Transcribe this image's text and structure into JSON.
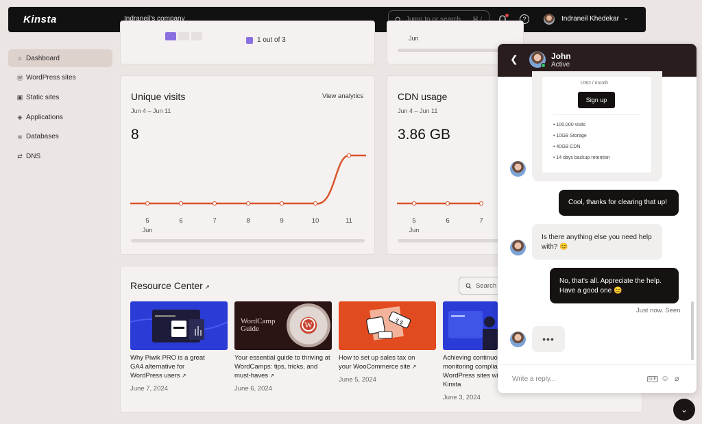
{
  "topbar": {
    "logo": "Kinsta",
    "company": "Indraneil's company",
    "search_placeholder": "Jump to or search...",
    "search_shortcut": "⌘ /",
    "user_name": "Indraneil Khedekar"
  },
  "sidebar": {
    "items": [
      {
        "label": "Dashboard",
        "icon": "home-icon"
      },
      {
        "label": "WordPress sites",
        "icon": "wordpress-icon"
      },
      {
        "label": "Static sites",
        "icon": "static-icon"
      },
      {
        "label": "Applications",
        "icon": "layers-icon"
      },
      {
        "label": "Databases",
        "icon": "database-icon"
      },
      {
        "label": "DNS",
        "icon": "dns-icon"
      }
    ]
  },
  "top_cards": {
    "legend_text": "1 out of 3",
    "jun_label": "Jun"
  },
  "unique_visits": {
    "title": "Unique visits",
    "date_range": "Jun 4 – Jun 11",
    "total": "8",
    "view_link": "View analytics",
    "month": "Jun"
  },
  "cdn_usage": {
    "title": "CDN usage",
    "date_range": "Jun 4 – Jun 11",
    "total": "3.86 GB",
    "month": "Jun"
  },
  "chart_data": [
    {
      "type": "area",
      "title": "Unique visits",
      "x": [
        5,
        6,
        7,
        8,
        9,
        10,
        11
      ],
      "x_month": "Jun",
      "values": [
        0,
        0,
        0,
        0,
        0,
        0,
        8
      ],
      "color": "#d9542b"
    },
    {
      "type": "line",
      "title": "CDN usage",
      "x": [
        5,
        6,
        7
      ],
      "x_month": "Jun",
      "values": [
        0,
        0,
        0
      ],
      "color": "#d9542b"
    }
  ],
  "resource_center": {
    "title": "Resource Center",
    "search_placeholder": "Search",
    "articles": [
      {
        "title": "Why Piwik PRO is a great GA4 alternative for WordPress users",
        "date": "June 7, 2024"
      },
      {
        "title": "Your essential guide to thriving at WordCamps: tips, tricks, and must-haves",
        "date": "June 6, 2024"
      },
      {
        "title": "How to set up sales tax on your WooCommerce site",
        "date": "June 5, 2024"
      },
      {
        "title": "Achieving continuous security monitoring compliance for WordPress sites with the Kinsta",
        "date": "June 3, 2024"
      }
    ],
    "wordcamp_thumb_text": "WordCamp Guide"
  },
  "chat": {
    "agent_name": "John",
    "agent_status": "Active",
    "plan_price_suffix": "USD / month",
    "plan_cta": "Sign up",
    "plan_features": [
      "100,000 visits",
      "10GB Storage",
      "40GB CDN",
      "14 days backup retention"
    ],
    "messages": [
      {
        "from": "user",
        "text": "Cool, thanks for clearing that up!"
      },
      {
        "from": "agent",
        "text": "Is there anything else you need help with? 😊"
      },
      {
        "from": "user",
        "text": "No, that's all. Appreciate the help. Have a good one 😊"
      }
    ],
    "seen_status": "Just now. Seen",
    "typing": "•••",
    "reply_placeholder": "Write a reply..."
  }
}
